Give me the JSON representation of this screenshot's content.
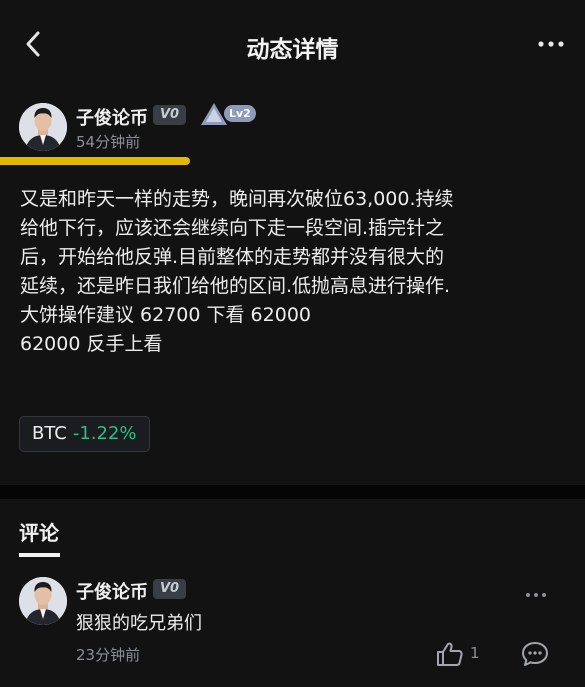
{
  "header": {
    "title": "动态详情"
  },
  "post": {
    "author": "子俊论币",
    "vip_label": "V0",
    "level_label": "Lv2",
    "time": "54分钟前",
    "lines": [
      "又是和昨天一样的走势，晚间再次破位63,000.持续",
      "给他下行，应该还会继续向下走一段空间.插完针之",
      "后，开始给他反弹.目前整体的走势都并没有很大的",
      "延续，还是昨日我们给他的区间.低抛高息进行操作.",
      "大饼操作建议  62700 下看 62000",
      "62000 反手上看"
    ],
    "coin": {
      "symbol": "BTC",
      "change": "-1.22%",
      "change_color": "#2ebd85"
    }
  },
  "comments": {
    "tab_label": "评论",
    "items": [
      {
        "author": "子俊论币",
        "vip_label": "V0",
        "text": "狠狠的吃兄弟们",
        "time": "23分钟前",
        "likes": "1"
      }
    ]
  },
  "icons": {
    "back": "chevron-left-icon",
    "more": "more-horizontal-icon",
    "like": "thumbs-up-icon",
    "reply": "comment-bubble-icon"
  },
  "colors": {
    "background": "#121212",
    "highlight_bar": "#e5b800",
    "positive": "#2ebd85"
  }
}
